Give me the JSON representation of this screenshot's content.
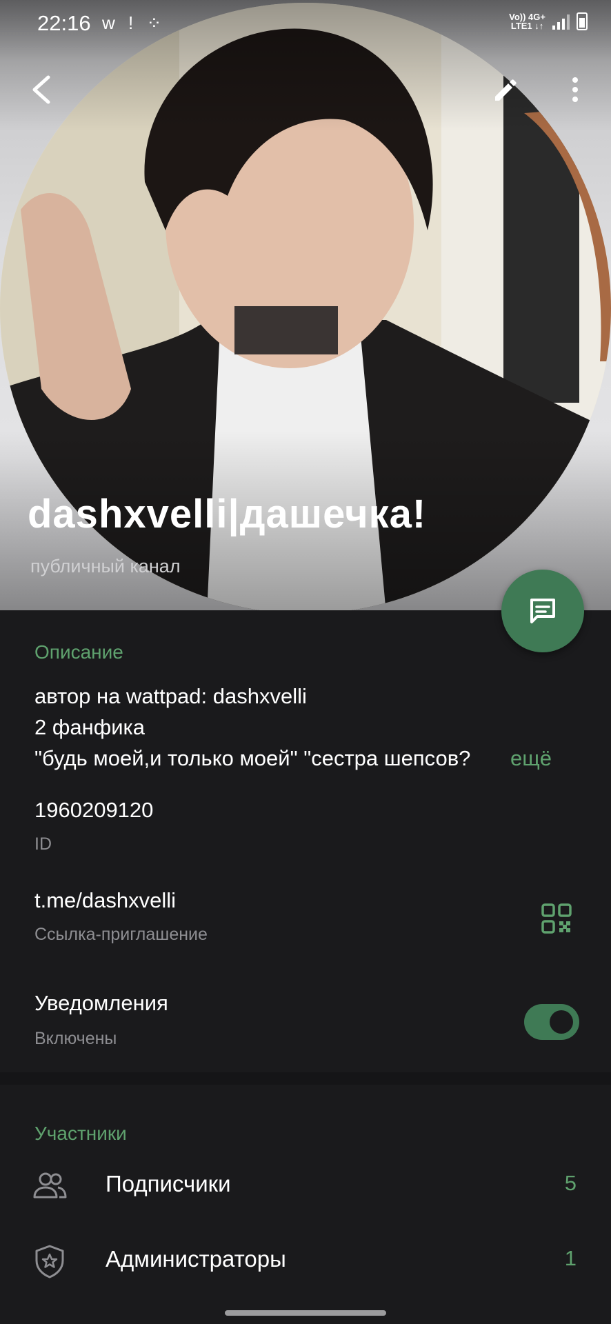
{
  "status_bar": {
    "time": "22:16",
    "left_icons": "w ! ⁘",
    "network_top": "Vo)) 4G+",
    "network_bottom": "LTE1 ↓↑"
  },
  "header": {
    "back_icon": "back-arrow-icon",
    "edit_icon": "pencil-icon",
    "more_icon": "more-vertical-icon",
    "title": "dashxvelli|дашечка!",
    "subtitle": "публичный канал"
  },
  "description": {
    "label": "Описание",
    "lines": [
      "автор на wattpad: dashxvelli",
      "2 фанфика",
      "\"будь моей,и только моей\" \"сестра шепсов?"
    ],
    "more": "ещё"
  },
  "id_item": {
    "value": "1960209120",
    "label": "ID"
  },
  "link_item": {
    "value": "t.me/dashxvelli",
    "label": "Ссылка-приглашение"
  },
  "notifications": {
    "title": "Уведомления",
    "status": "Включены",
    "enabled": true
  },
  "members": {
    "label": "Участники",
    "subscribers_label": "Подписчики",
    "subscribers_count": "5",
    "admins_label": "Администраторы",
    "admins_count": "1"
  },
  "colors": {
    "accent": "#5fa26e",
    "fab": "#3f7a55",
    "background": "#1a1a1c"
  }
}
